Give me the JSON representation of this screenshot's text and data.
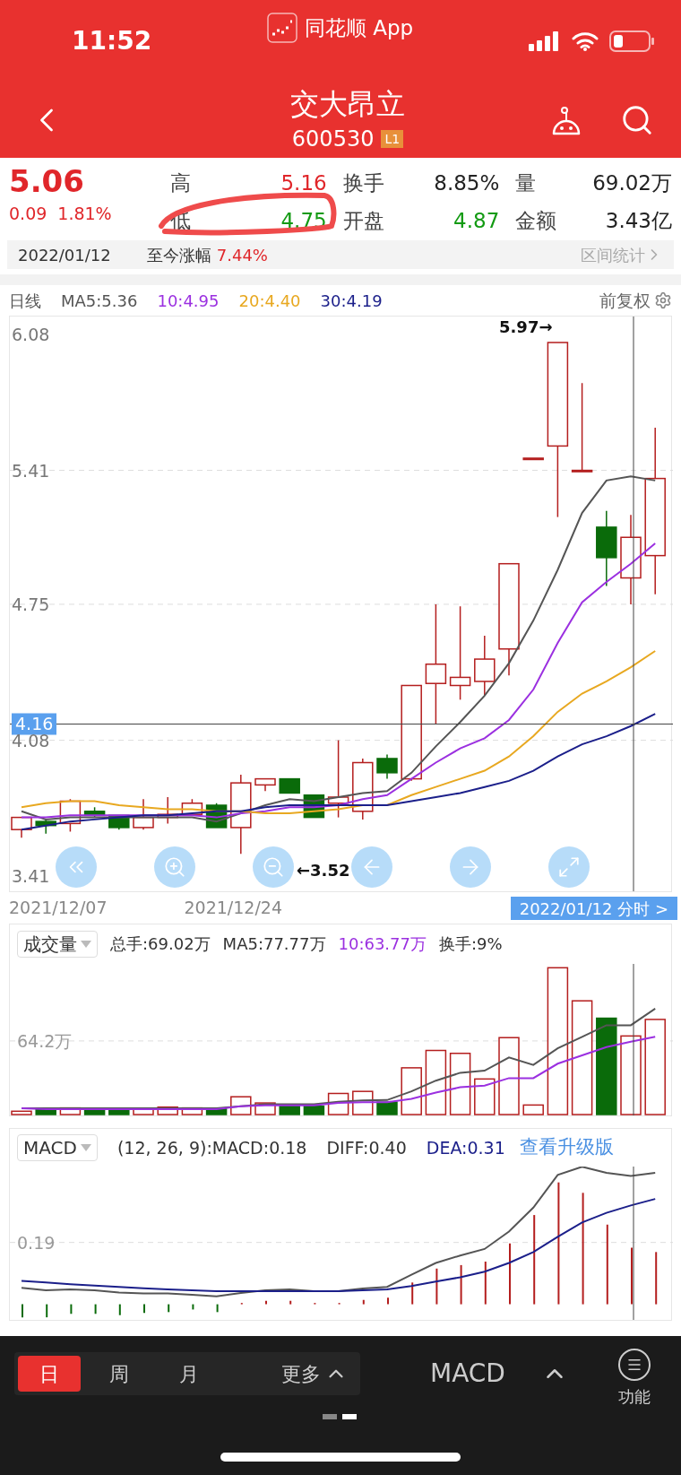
{
  "status_bar": {
    "time": "11:52",
    "app_name": "同花顺 App"
  },
  "header": {
    "title": "交大昂立",
    "code": "600530",
    "level_badge": "L1"
  },
  "quote": {
    "price": "5.06",
    "change": "0.09",
    "change_pct": "1.81%",
    "stats": [
      {
        "label": "高",
        "value": "5.16",
        "color": "#e0262a"
      },
      {
        "label": "换手",
        "value": "8.85%",
        "color": "#222222"
      },
      {
        "label": "量",
        "value": "69.02万",
        "color": "#222222"
      },
      {
        "label": "低",
        "value": "4.75",
        "color": "#129a12"
      },
      {
        "label": "开盘",
        "value": "4.87",
        "color": "#129a12"
      },
      {
        "label": "金额",
        "value": "3.43亿",
        "color": "#222222"
      }
    ]
  },
  "range_strip": {
    "date": "2022/01/12",
    "label": "至今涨幅",
    "value": "7.44%",
    "link": "区间统计"
  },
  "kline": {
    "period": "日线",
    "adjust": "前复权",
    "chart_data": {
      "type": "line",
      "ylim": [
        3.336,
        6.168
      ],
      "yticks": [
        6.08,
        5.41,
        4.75,
        4.08,
        3.41
      ],
      "grid": true,
      "ref_lines": [
        {
          "axis": "y",
          "value": 4.16,
          "color": "#444444"
        }
      ],
      "series": [
        {
          "name": "MA5:5.36",
          "color": "#555555",
          "values": [
            3.73,
            3.69,
            3.7,
            3.7,
            3.7,
            3.7,
            3.7,
            3.7,
            3.68,
            3.72,
            3.76,
            3.79,
            3.78,
            3.8,
            3.82,
            3.83,
            3.92,
            4.05,
            4.17,
            4.3,
            4.46,
            4.67,
            4.92,
            5.2,
            5.36,
            5.38,
            5.36
          ]
        },
        {
          "name": "10:4.95",
          "color": "#9b30e0",
          "values": [
            3.7,
            3.7,
            3.71,
            3.71,
            3.71,
            3.71,
            3.71,
            3.71,
            3.7,
            3.72,
            3.73,
            3.75,
            3.75,
            3.76,
            3.79,
            3.81,
            3.89,
            3.97,
            4.04,
            4.09,
            4.18,
            4.33,
            4.56,
            4.76,
            4.86,
            4.95,
            5.05
          ]
        },
        {
          "name": "20:4.40",
          "color": "#e8a820",
          "values": [
            3.75,
            3.77,
            3.78,
            3.78,
            3.76,
            3.75,
            3.74,
            3.74,
            3.73,
            3.73,
            3.72,
            3.72,
            3.73,
            3.74,
            3.76,
            3.76,
            3.81,
            3.85,
            3.89,
            3.93,
            4.0,
            4.1,
            4.22,
            4.31,
            4.37,
            4.44,
            4.52
          ]
        },
        {
          "name": "30:4.19",
          "color": "#1b1f8a",
          "values": [
            3.64,
            3.66,
            3.68,
            3.69,
            3.7,
            3.71,
            3.71,
            3.72,
            3.73,
            3.73,
            3.75,
            3.76,
            3.76,
            3.76,
            3.76,
            3.76,
            3.78,
            3.8,
            3.82,
            3.85,
            3.88,
            3.93,
            4.0,
            4.06,
            4.1,
            4.15,
            4.21
          ]
        }
      ]
    },
    "max_marker": "5.97→",
    "min_marker": "←3.52",
    "crosshair_value": "4.16",
    "dates": [
      "2021/12/07",
      "2021/12/24"
    ],
    "crosshair_button": "2022/01/12 分时 >"
  },
  "volume": {
    "selector": "成交量",
    "legend": [
      {
        "text": "总手:69.02万",
        "color": "#333333"
      },
      {
        "text": "MA5:77.77万",
        "color": "#333333"
      },
      {
        "text": "10:63.77万",
        "color": "#9b30e0"
      },
      {
        "text": "换手:9%",
        "color": "#333333"
      }
    ],
    "y_label": "64.2万"
  },
  "macd": {
    "selector": "MACD",
    "legend": [
      {
        "text": "(12, 26, 9):MACD:0.18",
        "color": "#333333"
      },
      {
        "text": "DIFF:0.40",
        "color": "#333333"
      },
      {
        "text": "DEA:0.31",
        "color": "#1b1f8a"
      }
    ],
    "upgrade_link": "查看升级版",
    "y_label": "0.19"
  },
  "bottom_bar": {
    "periods": [
      {
        "label": "日",
        "selected": true
      },
      {
        "label": "周",
        "selected": false
      },
      {
        "label": "月",
        "selected": false
      }
    ],
    "more": "更多",
    "indicator": "MACD",
    "function": "功能"
  }
}
